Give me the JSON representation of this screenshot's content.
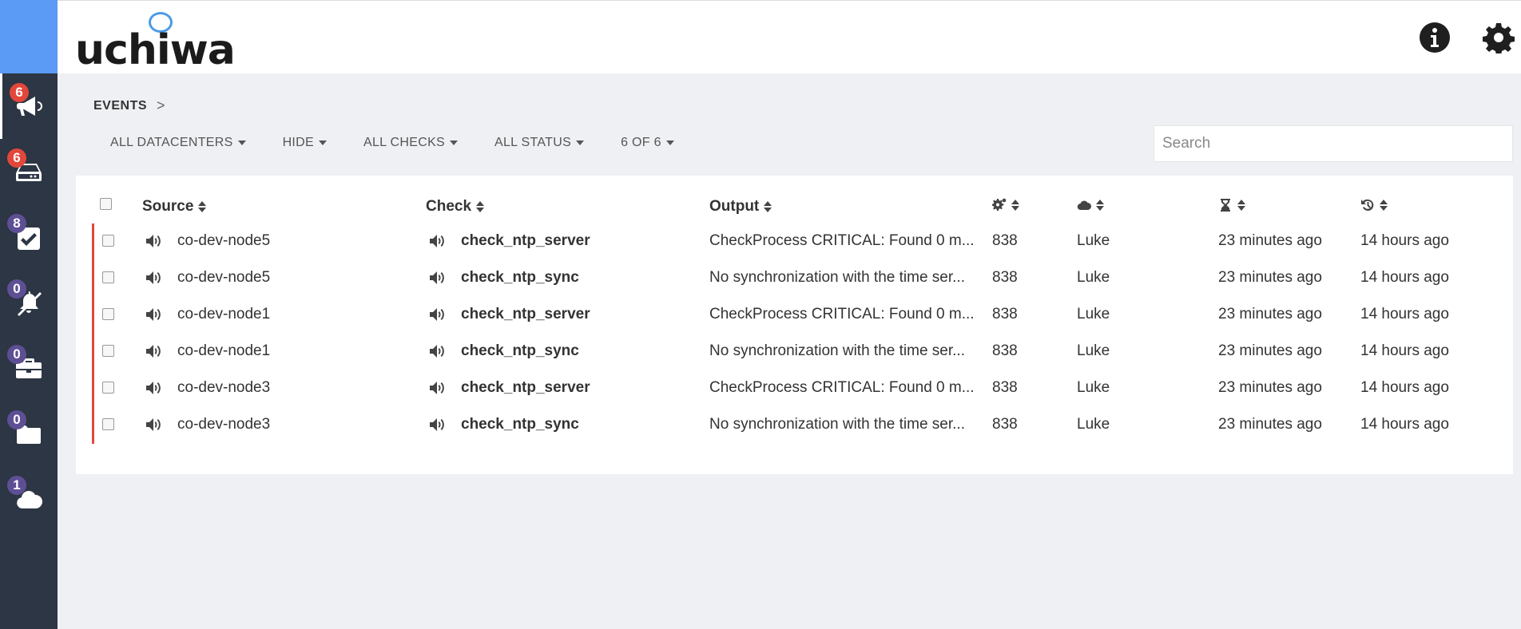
{
  "sidebar": {
    "items": [
      {
        "name": "events",
        "icon": "bullhorn-icon",
        "badge": "6",
        "badge_color": "#e2473b",
        "active": true
      },
      {
        "name": "clients",
        "icon": "hdd-icon",
        "badge": "6",
        "badge_color": "#e2473b"
      },
      {
        "name": "checks",
        "icon": "check-square-icon",
        "badge": "8",
        "badge_color": "#5e4f95"
      },
      {
        "name": "silenced",
        "icon": "bell-slash-icon",
        "badge": "0",
        "badge_color": "#5e4f95"
      },
      {
        "name": "stashes",
        "icon": "briefcase-icon",
        "badge": "0",
        "badge_color": "#5e4f95"
      },
      {
        "name": "aggregates",
        "icon": "folder-icon",
        "badge": "0",
        "badge_color": "#5e4f95"
      },
      {
        "name": "datacenters",
        "icon": "cloud-icon",
        "badge": "1",
        "badge_color": "#5e4f95"
      }
    ]
  },
  "header": {
    "logo_text": "uchiwa",
    "icons": [
      "info-circle-icon",
      "gear-icon"
    ]
  },
  "breadcrumb": {
    "label": "EVENTS",
    "separator": ">"
  },
  "filters": {
    "datacenters": "ALL DATACENTERS",
    "hide": "HIDE",
    "checks": "ALL CHECKS",
    "status": "ALL STATUS",
    "count": "6 OF 6"
  },
  "search": {
    "placeholder": "Search"
  },
  "table": {
    "headers": {
      "source": "Source",
      "check": "Check",
      "output": "Output",
      "occurrences_icon": "cogs-icon",
      "datacenter_icon": "cloud-icon",
      "issued_icon": "hourglass-icon",
      "last_check_icon": "history-icon"
    },
    "rows": [
      {
        "source": "co-dev-node5",
        "check": "check_ntp_server",
        "output": "CheckProcess CRITICAL: Found 0 m...",
        "occurrences": "838",
        "datacenter": "Luke",
        "issued": "23 minutes ago",
        "last": "14 hours ago"
      },
      {
        "source": "co-dev-node5",
        "check": "check_ntp_sync",
        "output": "No synchronization with the time ser...",
        "occurrences": "838",
        "datacenter": "Luke",
        "issued": "23 minutes ago",
        "last": "14 hours ago"
      },
      {
        "source": "co-dev-node1",
        "check": "check_ntp_server",
        "output": "CheckProcess CRITICAL: Found 0 m...",
        "occurrences": "838",
        "datacenter": "Luke",
        "issued": "23 minutes ago",
        "last": "14 hours ago"
      },
      {
        "source": "co-dev-node1",
        "check": "check_ntp_sync",
        "output": "No synchronization with the time ser...",
        "occurrences": "838",
        "datacenter": "Luke",
        "issued": "23 minutes ago",
        "last": "14 hours ago"
      },
      {
        "source": "co-dev-node3",
        "check": "check_ntp_server",
        "output": "CheckProcess CRITICAL: Found 0 m...",
        "occurrences": "838",
        "datacenter": "Luke",
        "issued": "23 minutes ago",
        "last": "14 hours ago"
      },
      {
        "source": "co-dev-node3",
        "check": "check_ntp_sync",
        "output": "No synchronization with the time ser...",
        "occurrences": "838",
        "datacenter": "Luke",
        "issued": "23 minutes ago",
        "last": "14 hours ago"
      }
    ],
    "status_color": "#e2473b"
  }
}
